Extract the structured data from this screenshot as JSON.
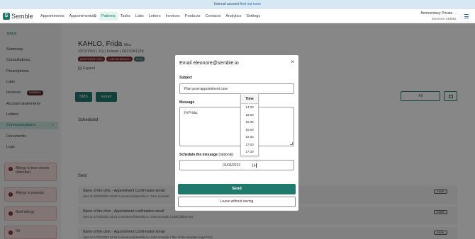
{
  "banner": {
    "text": "Internal account",
    "link": "find out more"
  },
  "app": {
    "logo_letter": "S",
    "logo_text": "Semble"
  },
  "nav": {
    "items": [
      "Appointments",
      "Appointments",
      "Patients",
      "Tasks",
      "Labs",
      "Letters",
      "Invoices",
      "Products",
      "Contacts",
      "Analytics",
      "Settings"
    ],
    "beta_icon": "⊠",
    "active": "Patients"
  },
  "practice": {
    "name": "Bermondsey Private ...",
    "user": "Eleonore SEMBL"
  },
  "sidebar": {
    "back": "BACK",
    "items": [
      "Summary",
      "Consultations",
      "Prescriptions",
      "Labs",
      "Invoices",
      "Account statements",
      "Letters",
      "Communications",
      "Documents",
      "Logs"
    ],
    "invoices_badge": "£40858.06",
    "active": "Communications",
    "alerts": [
      "Allergy to bee venom (disorder)",
      "Allergy to peanuts",
      "Beef allergy",
      "Nil"
    ]
  },
  "patient": {
    "name": "KAHLO, Frida",
    "title": "Miss",
    "dob": "23/11/1991",
    "age": "31y",
    "sex": "Female",
    "id": "XR27RN122K",
    "tags": [
      "NEW PATIENT 2021",
      "LONDON BRANCH",
      "TITLE"
    ],
    "expand": "Expand"
  },
  "actions": {
    "sms": "SMS",
    "email": "Email",
    "all": "All"
  },
  "sections": {
    "scheduled": "Scheduled",
    "sent": "Sent"
  },
  "sent": [
    {
      "title": "Name of the clinic - Appointment Confirmation Email",
      "meta": "Sent on 20/02/2023 15:35 to eleonore@semble.io | Sms & emails",
      "badge": "EMAIL"
    },
    {
      "title": "Name of the clinic - Appointment confirmation email",
      "meta": "Sent on 17/02/2023 15:23 to eleonore@semble.io | Sms & emails | Adult (follow-up)",
      "badge": "EMAIL"
    },
    {
      "title": "Name of the clinic - Appointment Confirmation Email",
      "meta": "Sent on 17/02/2023 12:42 to eleonore@semble.io | Sms & emails | Title of the template (Appt F2F)",
      "badge": "EMAIL"
    }
  ],
  "modal": {
    "title": "Email eleonore@semble.io",
    "close": "×",
    "subject_label": "Subject",
    "subject_value": "Plan post-appointment care",
    "message_label": "Message",
    "message_value": "Hi Frida,",
    "schedule_label": "Schedule the message",
    "schedule_optional": "(optional)",
    "schedule_date": "01/03/2023",
    "schedule_time": "16",
    "send": "Send",
    "leave": "Leave without saving"
  },
  "time_dropdown": {
    "header": "Time",
    "options": [
      "14:30",
      "15:00",
      "15:30",
      "16:00",
      "16:30",
      "17:00",
      "17:30"
    ]
  },
  "colors": {
    "accent": "#1f7a6d",
    "alert_bg": "#f6dede",
    "banner_bg": "#d7e8f5"
  }
}
